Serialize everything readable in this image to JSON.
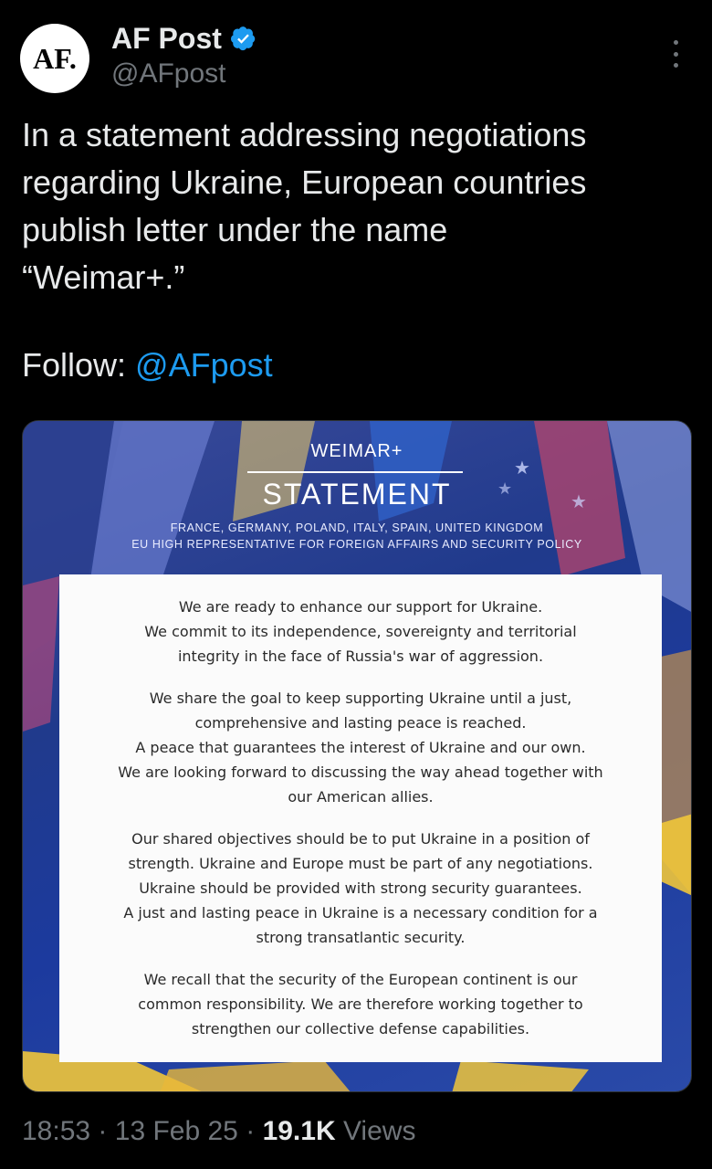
{
  "author": {
    "avatar_text": "AF.",
    "display_name": "AF Post",
    "handle": "@AFpost"
  },
  "tweet": {
    "text": "In a statement addressing negotiations\nregarding Ukraine, European countries\npublish letter under the name\n“Weimar+.”",
    "follow_label": "Follow:",
    "follow_handle": "@AFpost"
  },
  "media": {
    "kicker": "WEIMAR+",
    "heading": "STATEMENT",
    "countries_line1": "FRANCE, GERMANY, POLAND, ITALY, SPAIN, UNITED KINGDOM",
    "countries_line2": "EU HIGH REPRESENTATIVE FOR FOREIGN AFFAIRS AND SECURITY POLICY",
    "paragraphs": [
      "We are ready to enhance our support for Ukraine.\nWe commit to its independence, sovereignty and territorial\nintegrity in the face of Russia's war of aggression.",
      "We share the goal to keep supporting Ukraine until a just,\ncomprehensive and lasting peace is reached.\nA peace that guarantees the interest of Ukraine and our own.\nWe are looking forward to discussing the way ahead together with\nour American allies.",
      "Our shared objectives should be to put Ukraine in a position of\nstrength. Ukraine and Europe must be part of any negotiations.\nUkraine should be provided with strong security guarantees.\nA just and lasting peace in Ukraine is a necessary condition for a\nstrong transatlantic security.",
      "We recall that the security of the European continent is our\ncommon responsibility. We are therefore working together to\nstrengthen our collective defense capabilities."
    ]
  },
  "meta": {
    "time": "18:53",
    "separator": "·",
    "date": "13 Feb 25",
    "views_count": "19.1K",
    "views_label": "Views"
  },
  "icons": {
    "verified": "verified-badge-icon",
    "more": "more-vertical-icon"
  },
  "colors": {
    "background": "#000000",
    "text": "#e7e9ea",
    "muted": "#71767b",
    "accent": "#1d9bf0"
  }
}
